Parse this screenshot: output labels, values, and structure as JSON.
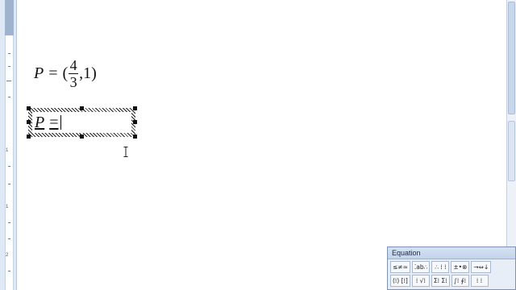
{
  "equation1": {
    "lhs": "P",
    "equals": "=",
    "open_paren": "(",
    "numerator": "4",
    "denominator": "3",
    "rest": ",1)"
  },
  "equation2": {
    "lhs": "P",
    "equals": "="
  },
  "ruler": {
    "numbers": [
      "1",
      "1",
      "2"
    ]
  },
  "toolbar": {
    "title": "Equation",
    "row1": [
      "≤≠≈",
      "⁚ab∴",
      "∴ ⁞ ⁞",
      "±•⊗",
      "→⇔↓"
    ],
    "row2": [
      "(⁞) [⁞]",
      "⁞ √⁞",
      "Σ⁞ Σ⁞",
      "∫⁞ ∮⁞",
      "⁞ ⁞"
    ]
  },
  "colors": {
    "ruler_bg": "#dfe9f5",
    "toolbar_bg": "#e8eef7",
    "toolbar_border": "#7d93b5"
  },
  "icons": {
    "cursor": "i-beam-cursor-icon"
  }
}
